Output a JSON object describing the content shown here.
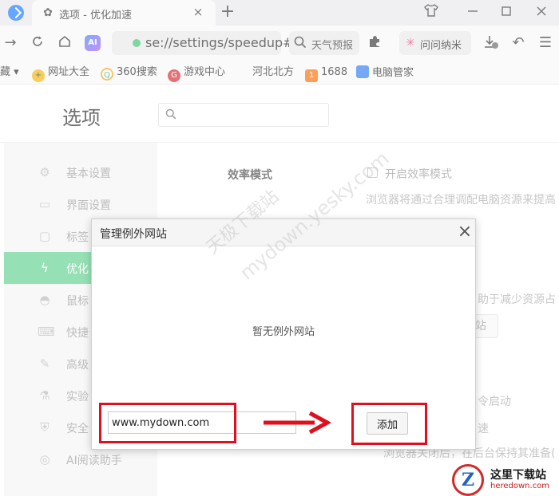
{
  "browser": {
    "tab_title": "选项 - 优化加速",
    "tab_close": "×",
    "new_tab": "+",
    "url": "se://settings/speedup#",
    "search_text": "天气预报",
    "wenwen_label": "问问纳米"
  },
  "bookmarks": [
    {
      "label": "藏 ▾",
      "icon": ""
    },
    {
      "label": "网址大全",
      "icon": "+"
    },
    {
      "label": "360搜索",
      "icon": "Q"
    },
    {
      "label": "游戏中心",
      "icon": "G"
    },
    {
      "label": "河北北方",
      "icon": ""
    },
    {
      "label": "1688",
      "icon": "1"
    },
    {
      "label": "电脑管家",
      "icon": ""
    }
  ],
  "settings": {
    "title": "选项",
    "sidebar": [
      {
        "label": "基本设置",
        "icon": "⚙"
      },
      {
        "label": "界面设置",
        "icon": "▭"
      },
      {
        "label": "标签",
        "icon": "▢"
      },
      {
        "label": "优化",
        "icon": "ϟ"
      },
      {
        "label": "鼠标",
        "icon": "◓"
      },
      {
        "label": "快捷",
        "icon": "⌨"
      },
      {
        "label": "高级",
        "icon": "✎"
      },
      {
        "label": "实验",
        "icon": "⚗"
      },
      {
        "label": "安全",
        "icon": "⛨"
      },
      {
        "label": "AI阅读助手",
        "icon": "◎"
      }
    ],
    "efficiency_heading": "效率模式",
    "efficiency_checkbox": "开启效率模式",
    "efficiency_desc": "浏览器将通过合理调配电脑资源来提高",
    "partial_1": "助于减少资源占",
    "partial_btn": "站",
    "partial_2": "令启动",
    "partial_3": "速",
    "partial_4": "浏览器关闭后，在后台保持其准备("
  },
  "dialog": {
    "title": "管理例外网站",
    "close": "×",
    "empty_text": "暂无例外网站",
    "input_value": "www.mydown.com",
    "add_button": "添加"
  },
  "watermark": {
    "line1": "天极下载站",
    "line2": "mydown.yesky.com"
  },
  "logo": {
    "mark": "Z",
    "text": "这里下载站",
    "url": "heredown.com"
  },
  "colors": {
    "accent": "#5fcf8e",
    "highlight": "#e10e1e"
  }
}
